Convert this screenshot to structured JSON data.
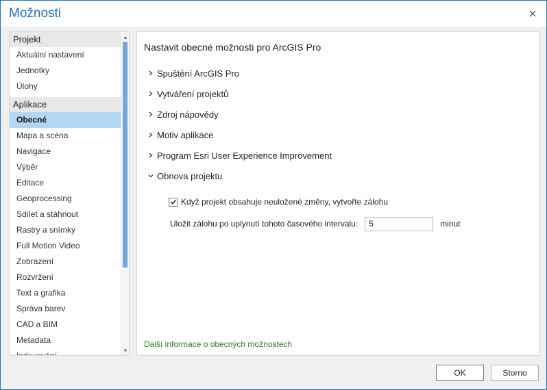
{
  "window": {
    "title": "Možnosti"
  },
  "sidebar": {
    "groups": [
      {
        "header": "Projekt",
        "items": [
          "Aktuální nastavení",
          "Jednotky",
          "Úlohy"
        ]
      },
      {
        "header": "Aplikace",
        "items": [
          "Obecné",
          "Mapa a scéna",
          "Navigace",
          "Výběr",
          "Editace",
          "Geoprocessing",
          "Sdílet a stáhnout",
          "Rastry a snímky",
          "Full Motion Video",
          "Zobrazení",
          "Rozvržení",
          "Text a grafika",
          "Správa barev",
          "CAD a BIM",
          "Metadata",
          "Indexování"
        ]
      }
    ],
    "selected": "Obecné"
  },
  "main": {
    "title": "Nastavit obecné možnosti pro ArcGIS Pro",
    "sections": [
      {
        "label": "Spuštění ArcGIS Pro",
        "expanded": false
      },
      {
        "label": "Vytváření projektů",
        "expanded": false
      },
      {
        "label": "Zdroj nápovědy",
        "expanded": false
      },
      {
        "label": "Motiv aplikace",
        "expanded": false
      },
      {
        "label": "Program Esri User Experience Improvement",
        "expanded": false
      },
      {
        "label": "Obnova projektu",
        "expanded": true
      }
    ],
    "backup_checkbox": {
      "label": "Když projekt obsahuje neuložené změny, vytvořte zálohu",
      "checked": true
    },
    "interval": {
      "label": "Uložit zálohu po uplynutí tohoto časového intervalu:",
      "value": "5",
      "unit": "minut"
    },
    "more_info_link": "Další informace o obecných možnostech"
  },
  "buttons": {
    "ok": "OK",
    "cancel": "Storno"
  },
  "colors": {
    "accent": "#1e73be",
    "selection": "#b3d7f3",
    "link": "#2a7a22"
  }
}
